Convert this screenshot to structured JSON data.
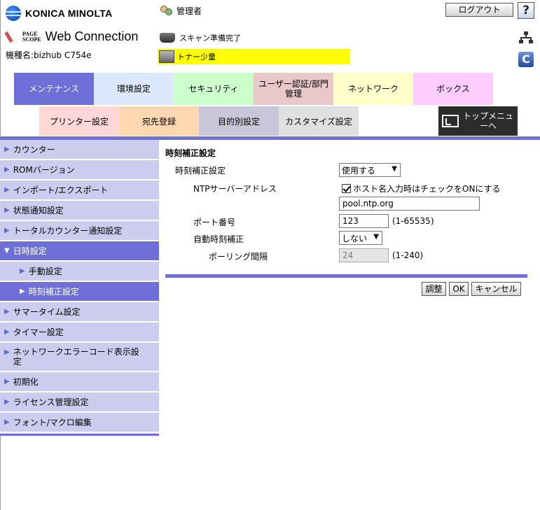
{
  "header": {
    "brand": "KONICA MINOLTA",
    "pagescope_small_line1": "PAGE",
    "pagescope_small_line2": "SCOPE",
    "product": "Web Connection",
    "model": "機種名:bizhub C754e",
    "user": "管理者",
    "scan_status": "スキャン準備完了",
    "toner_status": "トナー少量",
    "logout_label": "ログアウト",
    "help_label": "?",
    "refresh_label": "C"
  },
  "colors": {
    "accent": "#6f6fd8",
    "sidebar_bg": "#ccccee",
    "toner_bg": "#ffff00"
  },
  "main_tabs": [
    {
      "label": "メンテナンス",
      "bg": "#6f6fd8",
      "fg": "#ffffff"
    },
    {
      "label": "環境設定",
      "bg": "#dce8fb",
      "fg": "#000000"
    },
    {
      "label": "セキュリティ",
      "bg": "#ccffcc",
      "fg": "#000000"
    },
    {
      "label": "ユーザー認証/部門管理",
      "bg": "#e8c8c8",
      "fg": "#000000"
    },
    {
      "label": "ネットワーク",
      "bg": "#ffffcc",
      "fg": "#000000"
    },
    {
      "label": "ボックス",
      "bg": "#ffccff",
      "fg": "#000000"
    }
  ],
  "sub_tabs": [
    {
      "label": "プリンター設定",
      "bg": "#ffd7d7"
    },
    {
      "label": "宛先登録",
      "bg": "#ffd7b0"
    },
    {
      "label": "目的別設定",
      "bg": "#c7c7d9"
    },
    {
      "label": "カスタマイズ設定",
      "bg": "#e0e0e0"
    }
  ],
  "top_menu_label": "トップメニューへ",
  "sidebar": {
    "items": [
      {
        "label": "カウンター"
      },
      {
        "label": "ROMバージョン"
      },
      {
        "label": "インポート/エクスポート"
      },
      {
        "label": "状態通知設定"
      },
      {
        "label": "トータルカウンター通知設定"
      },
      {
        "label": "日時設定"
      },
      {
        "label": "手動設定"
      },
      {
        "label": "時刻補正設定"
      },
      {
        "label": "サマータイム設定"
      },
      {
        "label": "タイマー設定"
      },
      {
        "label": "ネットワークエラーコード表示設定"
      },
      {
        "label": "初期化"
      },
      {
        "label": "ライセンス管理設定"
      },
      {
        "label": "フォント/マクロ編集"
      }
    ]
  },
  "form": {
    "title": "時刻補正設定",
    "time_adjust_label": "時刻補正設定",
    "time_adjust_value": "使用する",
    "ntp_label": "NTPサーバーアドレス",
    "hostname_checkbox_label": "ホスト名入力時はチェックをONにする",
    "ntp_value": "pool.ntp.org",
    "port_label": "ポート番号",
    "port_value": "123",
    "port_range": "(1-65535)",
    "auto_adjust_label": "自動時刻補正",
    "auto_adjust_value": "しない",
    "polling_label": "ポーリング間隔",
    "polling_value": "24",
    "polling_range": "(1-240)"
  },
  "buttons": {
    "adjust": "調整",
    "ok": "OK",
    "cancel": "キャンセル"
  }
}
